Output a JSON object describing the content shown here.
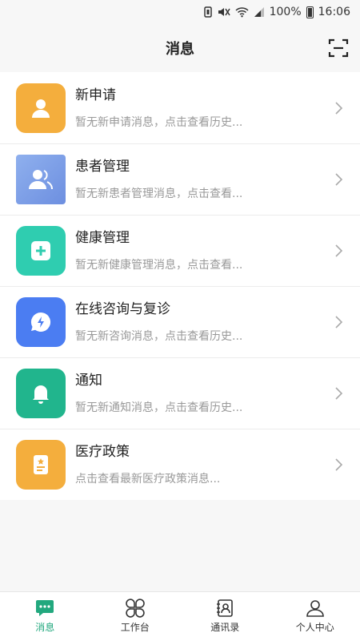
{
  "status_bar": {
    "battery": "100%",
    "time": "16:06"
  },
  "header": {
    "title": "消息",
    "scan_icon": "scan-icon"
  },
  "messages": [
    {
      "name": "新申请",
      "desc": "暂无新申请消息，点击查看历史...",
      "icon": "person-icon",
      "color": "#f4ae3d"
    },
    {
      "name": "患者管理",
      "desc": "暂无新患者管理消息，点击查看...",
      "icon": "patients-icon",
      "color": "#7f9fe6"
    },
    {
      "name": "健康管理",
      "desc": "暂无新健康管理消息，点击查看...",
      "icon": "health-plus-icon",
      "color": "#2fcdb0"
    },
    {
      "name": "在线咨询与复诊",
      "desc": "暂无新咨询消息，点击查看历史...",
      "icon": "consult-chat-icon",
      "color": "#4b7df2"
    },
    {
      "name": "通知",
      "desc": "暂无新通知消息，点击查看历史...",
      "icon": "bell-icon",
      "color": "#21b58d"
    },
    {
      "name": "医疗政策",
      "desc": "点击查看最新医疗政策消息...",
      "icon": "policy-doc-icon",
      "color": "#f4ae3d"
    }
  ],
  "tabbar": [
    {
      "label": "消息",
      "icon": "message-icon",
      "active": true,
      "active_color": "#22a87e"
    },
    {
      "label": "工作台",
      "icon": "workbench-icon",
      "active": false
    },
    {
      "label": "通讯录",
      "icon": "contacts-icon",
      "active": false
    },
    {
      "label": "个人中心",
      "icon": "profile-icon",
      "active": false
    }
  ]
}
